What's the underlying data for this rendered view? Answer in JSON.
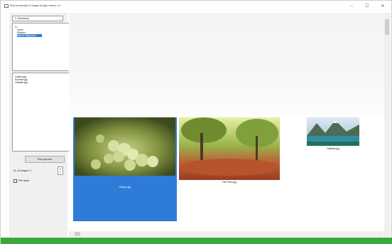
{
  "window": {
    "title": "Print thumbnails of images (Image viewer) 1.0",
    "minimize_glyph": "–",
    "maximize_glyph": "☐",
    "close_glyph": "✕"
  },
  "left_panel": {
    "drive_select": {
      "value": "C: [Windows]",
      "chevron": "⌄"
    },
    "tree": [
      {
        "label": "C:\\",
        "selected": false
      },
      {
        "label": "Users",
        "selected": false
      },
      {
        "label": "Pictures",
        "selected": false
      },
      {
        "label": "Nature Wallpapers",
        "selected": true
      }
    ],
    "files": [
      "Grapes.jpg",
      "Summer.jpg",
      "Oaklake.jpg"
    ],
    "print_button": "Print preview",
    "per_line_label": "Nr. of images: 3",
    "per_line_value": "3",
    "checkbox_label": "File name"
  },
  "thumbnails": [
    {
      "label": "Grapes.jpg",
      "selected": true
    },
    {
      "label": "Fall Trees.jpg",
      "selected": false
    },
    {
      "label": "Oaklake.jpg",
      "selected": false
    }
  ],
  "colors": {
    "selection": "#2f7bd8",
    "status_bar": "#39a937"
  }
}
